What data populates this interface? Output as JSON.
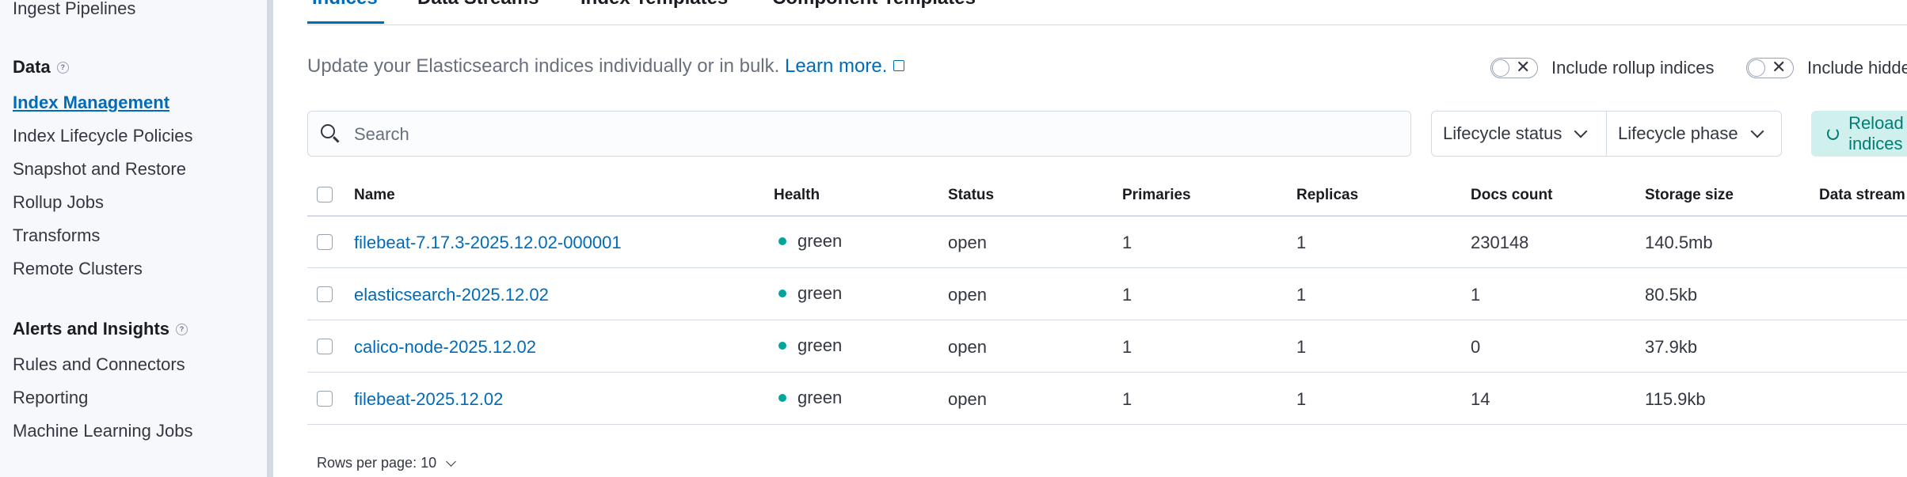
{
  "sidebar": {
    "top_item": "Ingest Pipelines",
    "data_heading": "Data",
    "data_items": [
      "Index Management",
      "Index Lifecycle Policies",
      "Snapshot and Restore",
      "Rollup Jobs",
      "Transforms",
      "Remote Clusters"
    ],
    "alerts_heading": "Alerts and Insights",
    "alerts_items": [
      "Rules and Connectors",
      "Reporting",
      "Machine Learning Jobs"
    ]
  },
  "tabs": [
    "Indices",
    "Data Streams",
    "Index Templates",
    "Component Templates"
  ],
  "description": {
    "text": "Update your Elasticsearch indices individually or in bulk. ",
    "link": "Learn more."
  },
  "toggles": {
    "rollup_label": "Include rollup indices",
    "hidden_label": "Include hidden indices"
  },
  "search": {
    "placeholder": "Search"
  },
  "filters": {
    "lifecycle_status": "Lifecycle status",
    "lifecycle_phase": "Lifecycle phase",
    "reload": "Reload indices"
  },
  "table": {
    "headers": [
      "Name",
      "Health",
      "Status",
      "Primaries",
      "Replicas",
      "Docs count",
      "Storage size",
      "Data stream"
    ],
    "rows": [
      {
        "name": "filebeat-7.17.3-2025.12.02-000001",
        "health": "green",
        "status": "open",
        "primaries": "1",
        "replicas": "1",
        "docs": "230148",
        "size": "140.5mb"
      },
      {
        "name": "elasticsearch-2025.12.02",
        "health": "green",
        "status": "open",
        "primaries": "1",
        "replicas": "1",
        "docs": "1",
        "size": "80.5kb"
      },
      {
        "name": "calico-node-2025.12.02",
        "health": "green",
        "status": "open",
        "primaries": "1",
        "replicas": "1",
        "docs": "0",
        "size": "37.9kb"
      },
      {
        "name": "filebeat-2025.12.02",
        "health": "green",
        "status": "open",
        "primaries": "1",
        "replicas": "1",
        "docs": "14",
        "size": "115.9kb"
      }
    ]
  },
  "pagination": {
    "rows_per_page": "Rows per page: 10"
  },
  "colors": {
    "accent": "#006bb8",
    "health_green": "#00a69b",
    "reload_bg": "#cff0ec"
  }
}
